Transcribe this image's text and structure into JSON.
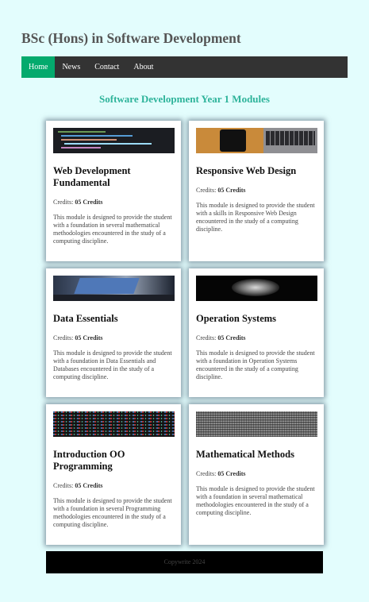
{
  "site": {
    "title": "BSc (Hons) in Software Development"
  },
  "nav": {
    "items": [
      {
        "label": "Home",
        "active": true
      },
      {
        "label": "News"
      },
      {
        "label": "Contact"
      },
      {
        "label": "About"
      }
    ]
  },
  "section": {
    "heading": "Software Development Year 1 Modules"
  },
  "credits_label": "Credits:",
  "modules": [
    {
      "title": "Web Development Fundamental",
      "credits": "05 Credits",
      "description": "This module is designed to provide the student with a foundation in several mathematical methodologies encountered in the study of a computing discipline.",
      "image_icon": "code-screenshot"
    },
    {
      "title": "Responsive Web Design",
      "credits": "05 Credits",
      "description": "This module is designed to provide the student with a skills in Responsive Web Design encountered in the study of a computing discipline.",
      "image_icon": "phone-and-laptop-photo"
    },
    {
      "title": "Data Essentials",
      "credits": "05 Credits",
      "description": "This module is designed to provide the student with a foundation in Data Essentials and Databases encountered in the study of a computing discipline.",
      "image_icon": "laptop-photo"
    },
    {
      "title": "Operation Systems",
      "credits": "05 Credits",
      "description": "This module is designed to provide the student with a foundation in Operation Systems encountered in the study of a computing discipline.",
      "image_icon": "dark-hardware-photo"
    },
    {
      "title": "Introduction OO Programming",
      "credits": "05 Credits",
      "description": "This module is designed to provide the student with a foundation in several Programming methodologies encountered in the study of a computing discipline.",
      "image_icon": "code-text-photo"
    },
    {
      "title": "Mathematical Methods",
      "credits": "05 Credits",
      "description": "This module is designed to provide the student with a foundation in several mathematical methodologies encountered in the study of a computing discipline.",
      "image_icon": "digital-noise-photo"
    }
  ],
  "footer": {
    "text": "Copywrite 2024"
  },
  "colors": {
    "background": "#e3fdfd",
    "nav_bg": "#333333",
    "nav_active": "#04aa6d",
    "heading": "#2db39a",
    "footer_bg": "#000000"
  }
}
